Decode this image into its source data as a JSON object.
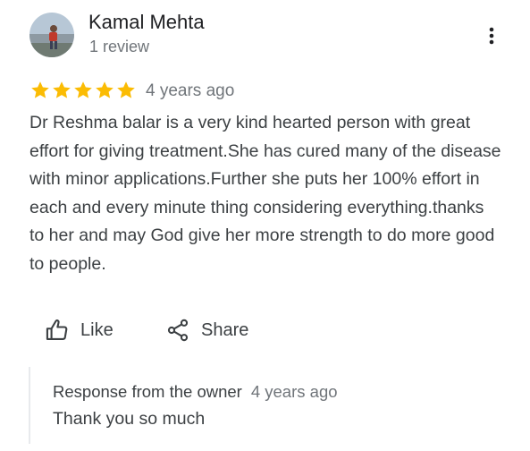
{
  "reviewer": {
    "name": "Kamal Mehta",
    "review_count": "1 review",
    "avatar": "profile-photo"
  },
  "review": {
    "rating": 5,
    "max_rating": 5,
    "star_color": "#fbbc04",
    "date": "4 years ago",
    "text": "Dr Reshma balar is a very kind hearted person with great effort for giving treatment.She has cured many of the disease with minor applications.Further she puts her 100% effort in each and every minute thing considering everything.thanks to her and may God give her more strength to do more good to people."
  },
  "actions": {
    "like_label": "Like",
    "like_icon": "thumbs-up-icon",
    "share_label": "Share",
    "share_icon": "share-icon",
    "more_icon": "more-vert-icon"
  },
  "owner_response": {
    "label": "Response from the owner",
    "date": "4 years ago",
    "text": "Thank you so much"
  },
  "colors": {
    "primary_text": "#202124",
    "secondary_text": "#70757a",
    "body_text": "#3c4043",
    "divider": "#e8eaed"
  }
}
